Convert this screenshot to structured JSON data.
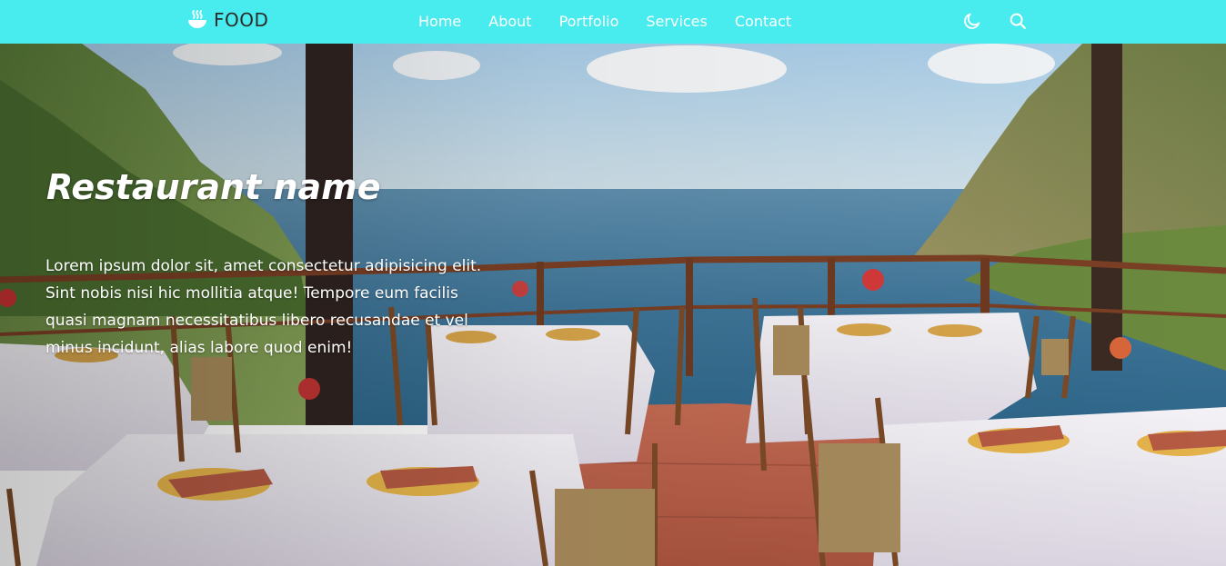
{
  "header": {
    "logo_text": "FOOD",
    "logo_icon": "bowl-icon",
    "nav": [
      {
        "label": "Home"
      },
      {
        "label": "About"
      },
      {
        "label": "Portfolio"
      },
      {
        "label": "Services"
      },
      {
        "label": "Contact"
      }
    ],
    "theme_toggle_icon": "moon-icon",
    "search_icon": "search-icon"
  },
  "hero": {
    "title": "Restaurant name",
    "description": "Lorem ipsum dolor sit, amet consectetur adipisicing elit. Sint nobis nisi hic mollitia atque! Tempore eum facilis quasi magnam necessitatibus libero recusandae et vel minus incidunt, alias labore quod enim!",
    "background_image": "restaurant-terrace-sea-view"
  },
  "colors": {
    "nav_background": "#48ecef",
    "nav_text": "#ffffff",
    "logo_text": "#2b2b2b",
    "hero_text": "#ffffff"
  }
}
